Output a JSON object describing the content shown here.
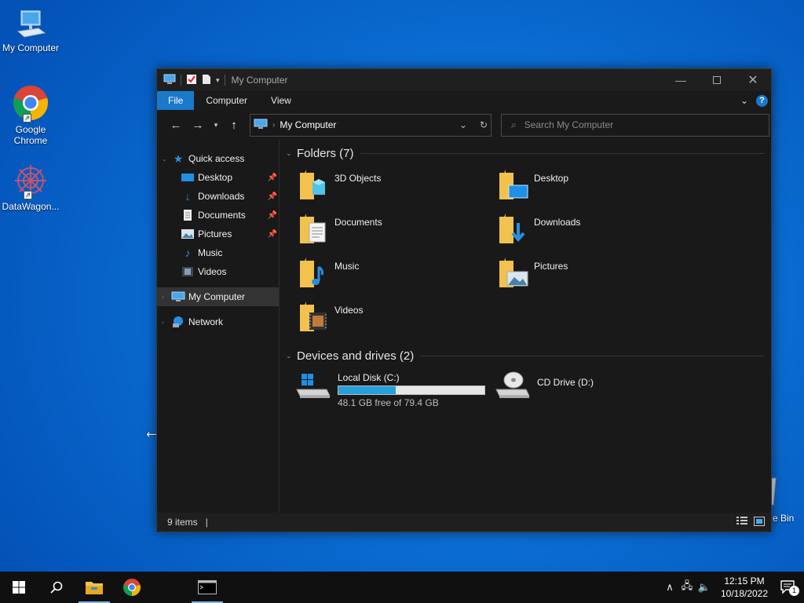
{
  "desktop": {
    "icons": [
      {
        "label": "My Computer",
        "icon": "computer-icon"
      },
      {
        "label": "Google Chrome",
        "icon": "chrome-icon"
      },
      {
        "label": "DataWagon...",
        "icon": "datawagon-icon"
      }
    ],
    "recycle_bin_label": "e Bin"
  },
  "window": {
    "title": "My Computer",
    "ribbon": {
      "file": "File",
      "computer": "Computer",
      "view": "View",
      "help": "?"
    },
    "address": {
      "crumb": "My Computer"
    },
    "search": {
      "placeholder": "Search My Computer"
    },
    "nav": {
      "quick_access": "Quick access",
      "items": [
        {
          "label": "Desktop",
          "pinned": true
        },
        {
          "label": "Downloads",
          "pinned": true
        },
        {
          "label": "Documents",
          "pinned": true
        },
        {
          "label": "Pictures",
          "pinned": true
        },
        {
          "label": "Music",
          "pinned": false
        },
        {
          "label": "Videos",
          "pinned": false
        }
      ],
      "my_computer": "My Computer",
      "network": "Network"
    },
    "content": {
      "folders_header": "Folders (7)",
      "folders": [
        "3D Objects",
        "Desktop",
        "Documents",
        "Downloads",
        "Music",
        "Pictures",
        "Videos"
      ],
      "drives_header": "Devices and drives (2)",
      "drives": [
        {
          "name": "Local Disk (C:)",
          "free": "48.1 GB free of 79.4 GB",
          "used_fraction": 0.394
        },
        {
          "name": "CD Drive (D:)"
        }
      ]
    },
    "status": {
      "items": "9 items"
    }
  },
  "taskbar": {
    "time": "12:15 PM",
    "date": "10/18/2022",
    "notifications": "1"
  },
  "colors": {
    "accent": "#1979ca",
    "progress": "#26a0da",
    "folder": "#f2c14e"
  }
}
